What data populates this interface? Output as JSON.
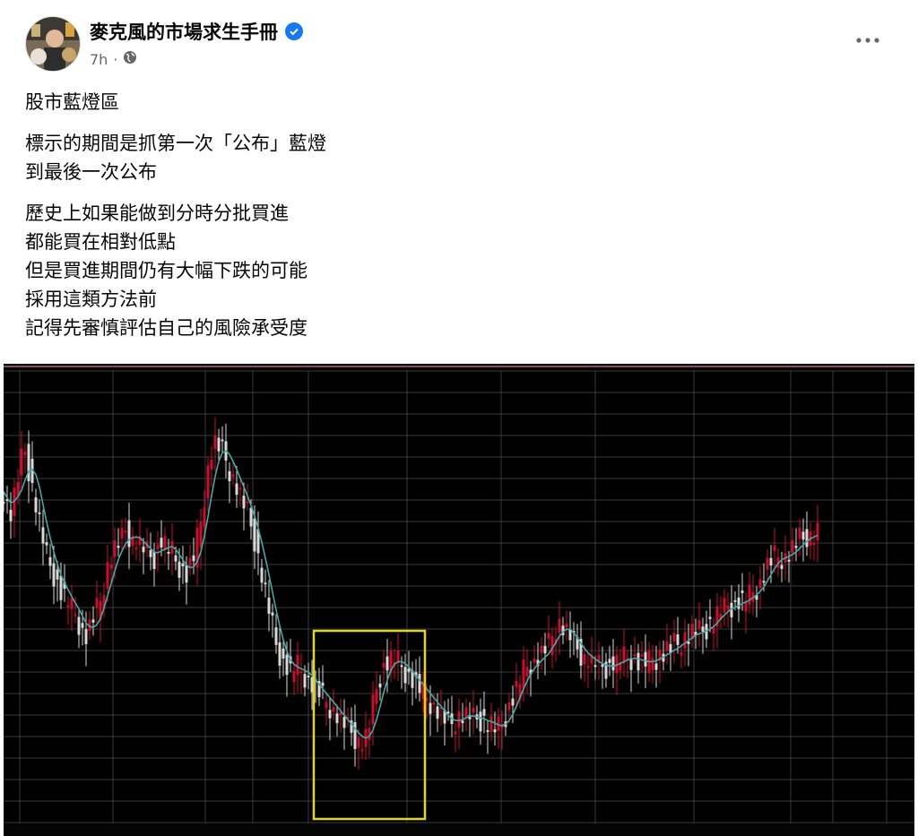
{
  "post": {
    "author": "麥克風的市場求生手冊",
    "time": "7h",
    "separator": "·",
    "verified": true,
    "paragraphs": [
      [
        "股市藍燈區"
      ],
      [
        "標示的期間是抓第一次「公布」藍燈",
        "到最後一次公布"
      ],
      [
        "歷史上如果能做到分時分批買進",
        "都能買在相對低點",
        "但是買進期間仍有大幅下跌的可能",
        "採用這類方法前",
        "記得先審慎評估自己的風險承受度"
      ]
    ]
  },
  "icons": {
    "verified": "verified-badge-icon",
    "audience": "globe-icon",
    "more": "more-options-icon"
  },
  "colors": {
    "accent": "#1877f2",
    "chart_background": "#000000",
    "grid": "#3a3a3a",
    "candle_up": "#c8102e",
    "candle_down": "#d8d8d8",
    "moving_average": "#4aa6a6",
    "highlight_box": "#e6d619"
  },
  "chart_data": {
    "type": "line",
    "title": "",
    "xlabel": "",
    "ylabel": "",
    "grid": true,
    "ylim": [
      0,
      100
    ],
    "x": [
      0,
      4,
      8,
      12,
      16,
      20,
      24,
      28,
      32,
      36,
      40,
      44,
      48,
      52,
      56,
      60,
      64,
      68,
      72,
      76,
      80,
      84,
      88,
      92,
      96,
      100,
      104,
      108,
      112,
      116,
      120,
      124,
      128,
      132,
      136,
      140,
      144,
      148,
      152,
      156,
      160,
      164,
      168,
      172,
      176,
      180,
      184,
      188,
      192,
      196,
      200,
      204,
      208,
      212,
      216,
      220,
      224,
      228,
      232,
      236,
      240,
      244,
      248,
      252,
      256,
      260,
      264,
      268,
      272,
      276,
      280,
      284,
      288,
      292,
      296,
      300,
      304,
      308,
      312,
      316,
      320,
      324,
      328,
      332,
      336,
      340,
      344,
      348,
      352,
      356,
      360,
      364,
      368,
      372,
      376,
      380,
      384,
      388,
      392,
      396,
      400,
      404,
      408,
      412,
      416,
      420,
      424,
      428,
      432,
      436,
      440,
      444,
      448,
      452,
      456,
      460,
      464,
      468,
      472,
      476,
      480,
      484,
      488,
      492,
      496,
      500,
      504,
      508,
      512,
      516,
      520,
      524,
      528,
      532,
      536,
      540,
      544,
      548,
      552,
      556,
      560,
      564,
      568,
      572,
      576,
      580,
      584,
      588,
      592,
      596,
      600,
      604,
      608,
      612,
      616,
      620,
      624,
      628,
      632,
      636,
      640,
      644,
      648,
      652,
      656,
      660,
      664,
      668,
      672,
      676,
      680,
      684,
      688,
      692,
      696,
      700,
      704,
      708,
      712,
      716,
      720,
      724,
      728,
      732,
      736,
      740,
      744,
      748,
      752,
      756,
      760,
      764,
      768,
      772,
      776,
      780,
      784,
      788,
      792,
      796,
      800,
      804,
      808,
      812,
      816,
      820,
      824,
      828,
      832,
      836,
      840,
      844,
      848,
      852,
      856,
      860,
      864,
      868,
      872,
      876,
      880,
      884,
      888,
      892,
      896,
      900,
      904,
      908,
      912,
      916,
      920,
      924,
      928,
      932,
      936,
      940,
      944,
      948,
      952,
      956,
      960,
      964,
      968,
      972,
      976,
      980,
      984,
      988,
      992,
      996,
      1000,
      1004,
      1008,
      1012,
      1016
    ],
    "series": [
      {
        "values": [
          73,
          70,
          68,
          72,
          76,
          80,
          82,
          78,
          74,
          70,
          66,
          62,
          58,
          56,
          54,
          52,
          50,
          49,
          48,
          46,
          45,
          43,
          41,
          40,
          42,
          44,
          46,
          48,
          52,
          56,
          58,
          60,
          61,
          62,
          64,
          63,
          62,
          62,
          61,
          60,
          59,
          58,
          58,
          60,
          62,
          61,
          60,
          59,
          57,
          56,
          55,
          54,
          56,
          58,
          62,
          66,
          72,
          78,
          82,
          84,
          83,
          82,
          80,
          78,
          76,
          74,
          72,
          70,
          68,
          65,
          62,
          58,
          54,
          50,
          46,
          42,
          38,
          36,
          34,
          33,
          32,
          33,
          33,
          32,
          31,
          30,
          29,
          28,
          27,
          26,
          25,
          24,
          23,
          22,
          21,
          20,
          19,
          18,
          17,
          16,
          16,
          17,
          20,
          24,
          28,
          31,
          33,
          34,
          35,
          35,
          34,
          33,
          32,
          31,
          30,
          29,
          28,
          27,
          26,
          25,
          24,
          23,
          22,
          21,
          20,
          20,
          21,
          22,
          22,
          22,
          22,
          21,
          21,
          21,
          21,
          20,
          20,
          19,
          19,
          20,
          22,
          24,
          26,
          28,
          30,
          32,
          33,
          34,
          34,
          35,
          36,
          37,
          38,
          40,
          42,
          43,
          42,
          41,
          40,
          38,
          37,
          36,
          35,
          35,
          34,
          34,
          33,
          33,
          33,
          33,
          34,
          34,
          35,
          35,
          35,
          35,
          35,
          34,
          34,
          34,
          34,
          35,
          35,
          36,
          36,
          37,
          37,
          38,
          38,
          39,
          40,
          40,
          41,
          41,
          41,
          41,
          42,
          43,
          44,
          45,
          46,
          46,
          47,
          47,
          47,
          48,
          48,
          49,
          49,
          50,
          51,
          52,
          54,
          56,
          57,
          58,
          58,
          58,
          58,
          59,
          60,
          61,
          62,
          62,
          63,
          63,
          63,
          64
        ]
      }
    ]
  }
}
